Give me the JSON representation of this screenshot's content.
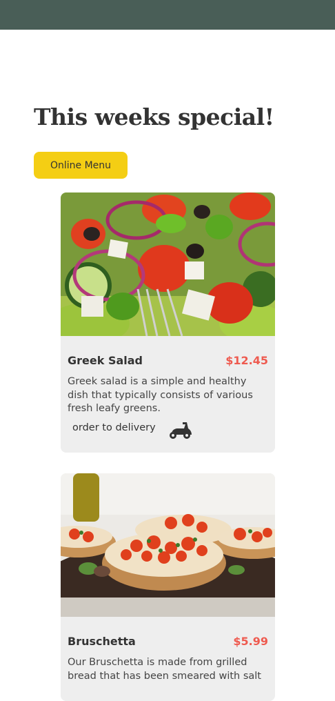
{
  "page": {
    "title": "This weeks special!",
    "menu_button": "Online Menu"
  },
  "colors": {
    "header_bg": "#495e57",
    "accent_yellow": "#f4ce14",
    "price_red": "#ee5a4f",
    "card_bg": "#eeeeee"
  },
  "specials": [
    {
      "image": "greek-salad-photo",
      "name": "Greek Salad",
      "price": "$12.45",
      "description": "Greek salad is a simple and healthy dish that typically consists of various fresh leafy greens.",
      "order_label": "order to delivery",
      "order_icon": "scooter-icon"
    },
    {
      "image": "bruschetta-photo",
      "name": "Bruschetta",
      "price": "$5.99",
      "description": "Our Bruschetta is made from grilled bread that has been smeared with salt"
    }
  ]
}
